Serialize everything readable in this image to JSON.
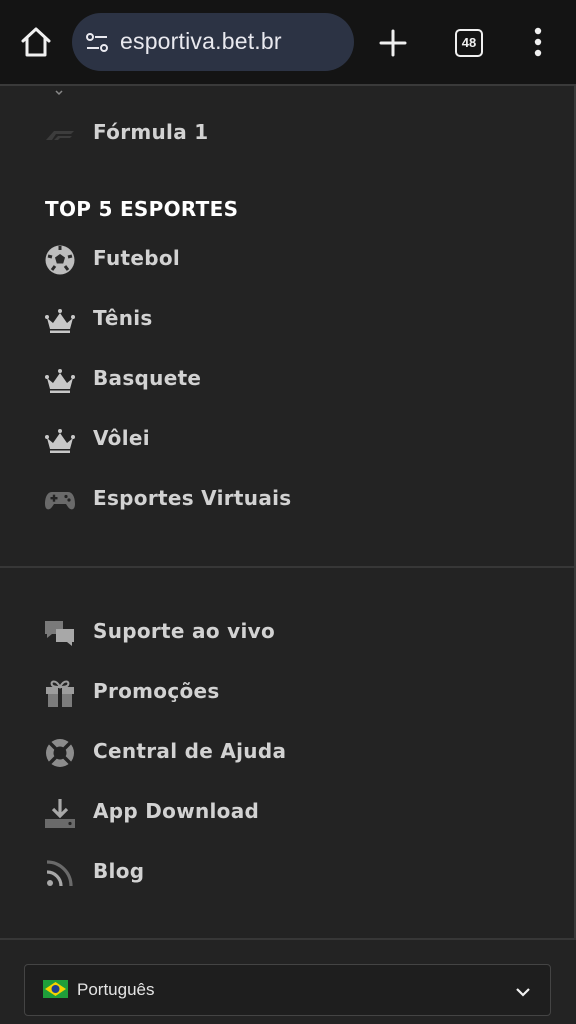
{
  "browser": {
    "url": "esportiva.bet.br",
    "tab_count": "48"
  },
  "menu": {
    "partial_items": [
      {
        "label": "Fórmula 1",
        "icon": "f1-logo-icon"
      }
    ],
    "top5": {
      "title": "TOP 5 ESPORTES",
      "items": [
        {
          "label": "Futebol",
          "icon": "soccer-ball-icon"
        },
        {
          "label": "Tênis",
          "icon": "crown-icon"
        },
        {
          "label": "Basquete",
          "icon": "crown-icon"
        },
        {
          "label": "Vôlei",
          "icon": "crown-icon"
        },
        {
          "label": "Esportes Virtuais",
          "icon": "gamepad-icon"
        }
      ]
    },
    "support": {
      "items": [
        {
          "label": "Suporte ao vivo",
          "icon": "chat-icon"
        },
        {
          "label": "Promoções",
          "icon": "gift-icon"
        },
        {
          "label": "Central de Ajuda",
          "icon": "lifebuoy-icon"
        },
        {
          "label": "App Download",
          "icon": "download-icon"
        },
        {
          "label": "Blog",
          "icon": "rss-icon"
        }
      ]
    }
  },
  "language": {
    "selected": "Português",
    "flag": "brazil-flag-icon"
  },
  "colors": {
    "background": "#232323",
    "topbar": "#141414",
    "urlbar": "#2c3344",
    "text": "#d2d2d2"
  }
}
